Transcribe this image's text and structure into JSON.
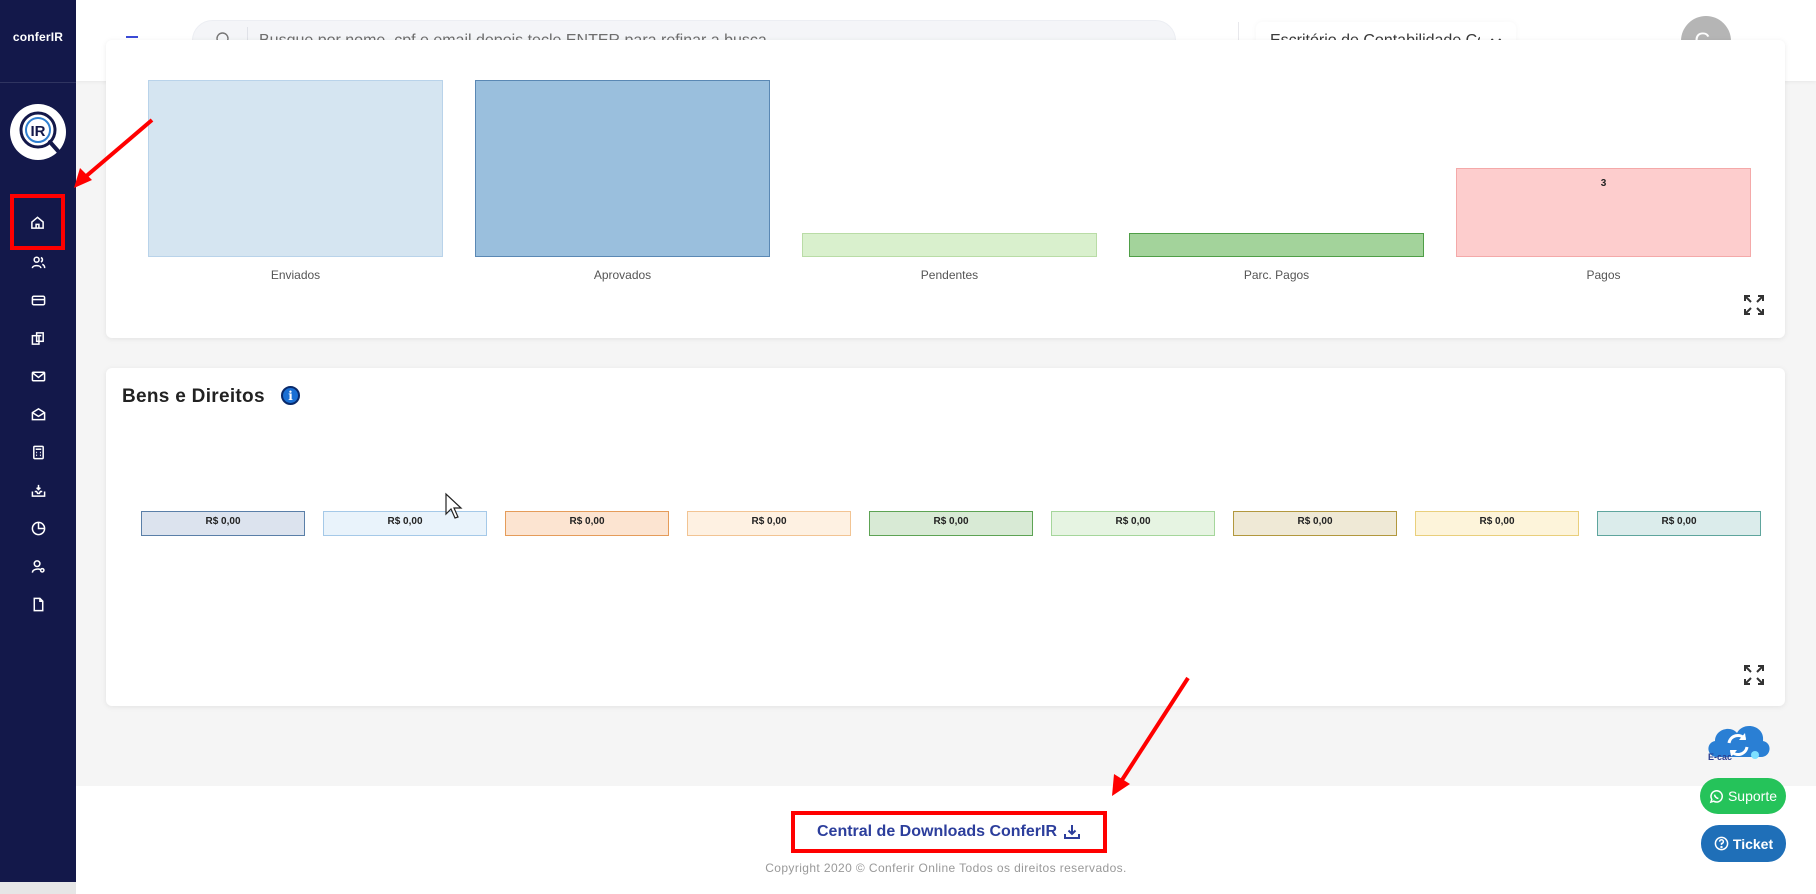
{
  "sidebar": {
    "brand": "conferIR",
    "logo_initials": "IR",
    "items": [
      {
        "icon": "home-icon",
        "active": true
      },
      {
        "icon": "users-icon"
      },
      {
        "icon": "credit-card-icon"
      },
      {
        "icon": "documents-icon"
      },
      {
        "icon": "mail-icon"
      },
      {
        "icon": "mail-open-icon"
      },
      {
        "icon": "calculator-icon"
      },
      {
        "icon": "inbox-download-icon"
      },
      {
        "icon": "pie-chart-icon"
      },
      {
        "icon": "user-settings-icon"
      },
      {
        "icon": "file-icon"
      }
    ]
  },
  "header": {
    "search_placeholder": "Busque por nome, cpf e email depois tecle ENTER para refinar a busca",
    "office_select_value": "Escritório de Contabilidade Co",
    "user_initials": "C-"
  },
  "top_chart": {
    "chart_data": {
      "type": "bar",
      "categories": [
        "Enviados",
        "Aprovados",
        "Pendentes",
        "Parc. Pagos",
        "Pagos"
      ],
      "value_labels": [
        "",
        "",
        "",
        "",
        "3"
      ],
      "colors": {
        "Enviados": "#d5e5f1",
        "Aprovados": "#9abfdd",
        "Pendentes": "#d9f0cd",
        "Parc. Pagos": "#a3d39b",
        "Pagos": "#fdcdcd"
      }
    }
  },
  "bens": {
    "title": "Bens e Direitos",
    "info": "i",
    "boxes": [
      {
        "label": "R$ 0,00",
        "bg": "#dce3ee",
        "border": "#5a7fa8"
      },
      {
        "label": "R$ 0,00",
        "bg": "#e9f3fb",
        "border": "#a5c9e8"
      },
      {
        "label": "R$ 0,00",
        "bg": "#fce4d1",
        "border": "#e59c5a"
      },
      {
        "label": "R$ 0,00",
        "bg": "#fef1e2",
        "border": "#f2c493"
      },
      {
        "label": "R$ 0,00",
        "bg": "#d8ead5",
        "border": "#5da354"
      },
      {
        "label": "R$ 0,00",
        "bg": "#e6f4e2",
        "border": "#a5d69b"
      },
      {
        "label": "R$ 0,00",
        "bg": "#efe9d6",
        "border": "#b2983e"
      },
      {
        "label": "R$ 0,00",
        "bg": "#fdf4da",
        "border": "#e9cf7c"
      },
      {
        "label": "R$ 0,00",
        "bg": "#dbeceb",
        "border": "#5ea59d"
      }
    ]
  },
  "footer": {
    "downloads_label": "Central de Downloads ConferIR",
    "copyright": "Copyright 2020 © Conferir Online Todos os direitos reservados."
  },
  "floating": {
    "ecac_label": "E-cac",
    "suporte_label": "Suporte",
    "ticket_label": "Ticket"
  },
  "annotation_color": "#ff0000"
}
